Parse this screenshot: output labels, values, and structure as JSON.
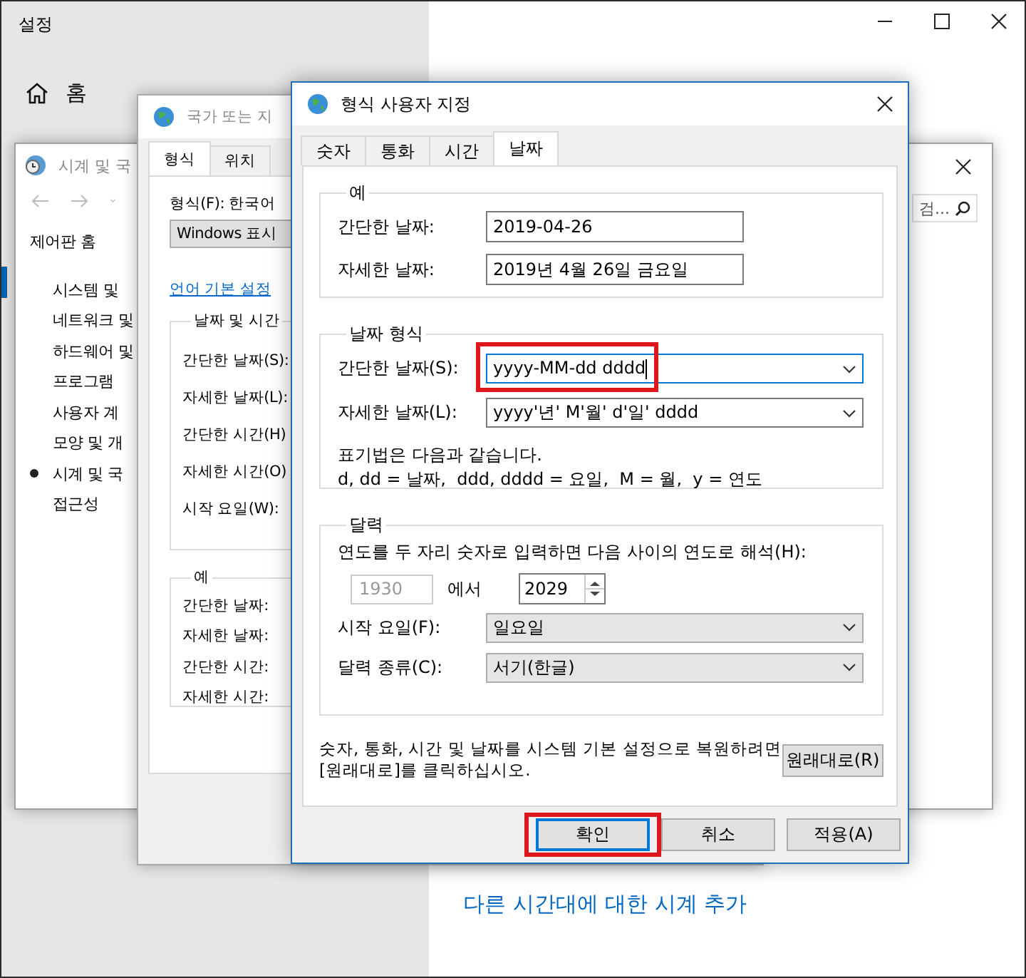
{
  "settings": {
    "title": "설정",
    "home": "홈",
    "link": "다른 시간대에 대한 시계 추가"
  },
  "control_panel": {
    "title": "시계 및 국",
    "search": {
      "placeholder": "검..."
    },
    "home_link": "제어판 홈",
    "items": [
      {
        "label": "시스템 및",
        "selected": false
      },
      {
        "label": "네트워크 및",
        "selected": false
      },
      {
        "label": "하드웨어 및",
        "selected": false
      },
      {
        "label": "프로그램",
        "selected": false
      },
      {
        "label": "사용자 계",
        "selected": false
      },
      {
        "label": "모양 및 개",
        "selected": false
      },
      {
        "label": "시계 및 국",
        "selected": true
      },
      {
        "label": "접근성",
        "selected": false
      }
    ]
  },
  "region_dialog": {
    "title": "국가 또는 지",
    "tabs": [
      {
        "label": "형식",
        "selected": true
      },
      {
        "label": "위치",
        "selected": false
      }
    ],
    "format_label": "형식(F): 한국어",
    "format_value": "Windows 표시",
    "language_link": "언어 기본 설정",
    "formats_group": {
      "title": "날짜 및 시간",
      "labels": [
        "간단한 날짜(S):",
        "자세한 날짜(L):",
        "간단한 시간(H)",
        "자세한 시간(O)",
        "시작 요일(W):"
      ]
    },
    "examples_group": {
      "title": "예",
      "labels": [
        "간단한 날짜:",
        "자세한 날짜:",
        "간단한 시간:",
        "자세한 시간:"
      ]
    }
  },
  "custom_dialog": {
    "title": "형식 사용자 지정",
    "tabs": [
      {
        "label": "숫자",
        "selected": false
      },
      {
        "label": "통화",
        "selected": false
      },
      {
        "label": "시간",
        "selected": false
      },
      {
        "label": "날짜",
        "selected": true
      }
    ],
    "examples": {
      "title": "예",
      "rows": [
        {
          "label": "간단한 날짜:",
          "value": "2019-04-26"
        },
        {
          "label": "자세한 날짜:",
          "value": "2019년 4월 26일 금요일"
        }
      ]
    },
    "date_formats": {
      "title": "날짜 형식",
      "rows": [
        {
          "label": "간단한 날짜(S):",
          "value": "yyyy-MM-dd dddd",
          "focused": true,
          "highlighted": true
        },
        {
          "label": "자세한 날짜(L):",
          "value": "yyyy'년' M'월' d'일' dddd",
          "focused": false,
          "highlighted": false
        }
      ],
      "notes": [
        "표기법은 다음과 같습니다.",
        "d, dd = 날짜,  ddd, dddd = 요일,  M = 월,  y = 연도"
      ]
    },
    "calendar": {
      "title": "달력",
      "two_digit_label": "연도를 두 자리 숫자로 입력하면 다음 사이의 연도로 해석(H):",
      "from_year": {
        "value": "1930",
        "disabled": true
      },
      "between": "에서",
      "to_year": "2029",
      "rows": [
        {
          "label": "시작 요일(F):",
          "value": "일요일"
        },
        {
          "label": "달력 종류(C):",
          "value": "서기(한글)"
        }
      ]
    },
    "reset_note": [
      "숫자, 통화, 시간 및 날짜를 시스템 기본 설정으로 복원하려면",
      "[원래대로]를 클릭하십시오."
    ],
    "reset_button": "원래대로(R)",
    "buttons": [
      {
        "label": "확인",
        "default": true,
        "highlighted": true
      },
      {
        "label": "취소",
        "default": false,
        "highlighted": false
      },
      {
        "label": "적용(A)",
        "default": false,
        "highlighted": false
      }
    ]
  }
}
